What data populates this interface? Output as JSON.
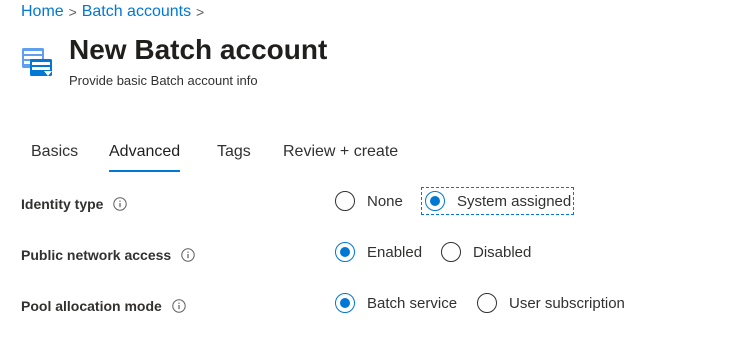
{
  "breadcrumb": {
    "items": [
      {
        "label": "Home"
      },
      {
        "label": "Batch accounts"
      }
    ],
    "separator": ">"
  },
  "header": {
    "title": "New Batch account",
    "subtitle": "Provide basic Batch account info",
    "icon": "batch-account-icon"
  },
  "tabs": [
    {
      "label": "Basics",
      "active": false
    },
    {
      "label": "Advanced",
      "active": true
    },
    {
      "label": "Tags",
      "active": false
    },
    {
      "label": "Review + create",
      "active": false
    }
  ],
  "form": {
    "identity_type": {
      "label": "Identity type",
      "options": [
        {
          "label": "None",
          "checked": false
        },
        {
          "label": "System assigned",
          "checked": true
        }
      ]
    },
    "public_network_access": {
      "label": "Public network access",
      "options": [
        {
          "label": "Enabled",
          "checked": true
        },
        {
          "label": "Disabled",
          "checked": false
        }
      ]
    },
    "pool_allocation_mode": {
      "label": "Pool allocation mode",
      "options": [
        {
          "label": "Batch service",
          "checked": true
        },
        {
          "label": "User subscription",
          "checked": false
        }
      ]
    }
  },
  "colors": {
    "accent": "#0078d4",
    "text": "#323130",
    "title": "#201f1e"
  }
}
